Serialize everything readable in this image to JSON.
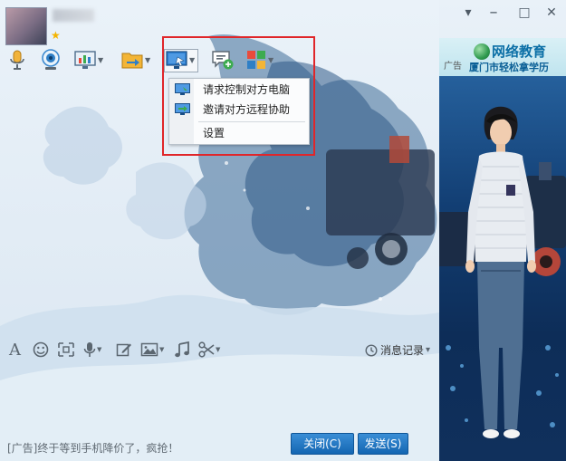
{
  "window": {
    "star": "★",
    "minimize": "▾",
    "maximize": "▭",
    "restore": "□",
    "close": "✕"
  },
  "toolbar": {
    "items": [
      "mic-icon",
      "camera-icon",
      "screen-share-icon",
      "file-transfer-icon",
      "remote-desktop-icon",
      "new-chat-icon",
      "apps-icon"
    ]
  },
  "remote_menu": {
    "items": [
      {
        "label": "请求控制对方电脑",
        "icon": "monitor-control-icon"
      },
      {
        "label": "邀请对方远程协助",
        "icon": "monitor-invite-icon"
      },
      {
        "label": "设置",
        "icon": ""
      }
    ]
  },
  "ad_panel": {
    "tag": "广告",
    "title": "网络教育",
    "subtitle": "厦门市轻松拿学历"
  },
  "format_bar": {
    "font_glyph": "A",
    "history_label": "消息记录",
    "history_arrow": "▾"
  },
  "footer": {
    "ad_text": "[广告]终于等到手机降价了，疯抢！",
    "close_button": "关闭(C)",
    "send_button": "发送(S)"
  },
  "colors": {
    "accent": "#1466b2",
    "highlight": "#e0262a"
  }
}
